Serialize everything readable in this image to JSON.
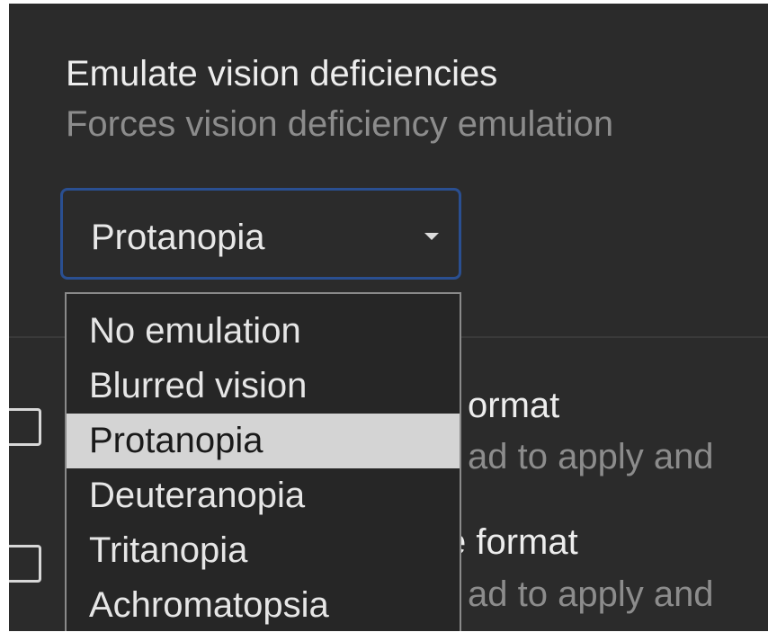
{
  "setting": {
    "title": "Emulate vision deficiencies",
    "description": "Forces vision deficiency emulation",
    "selected_value": "Protanopia",
    "arrow_icon": "caret-down-icon"
  },
  "dropdown": {
    "options": [
      "No emulation",
      "Blurred vision",
      "Protanopia",
      "Deuteranopia",
      "Tritanopia",
      "Achromatopsia"
    ],
    "highlighted_index": 2
  },
  "background_settings": [
    {
      "label_visible": "ormat",
      "description_visible": "ad to apply and",
      "checked": false
    },
    {
      "label_visible": "e format",
      "description_visible": "ad to apply and",
      "checked": false
    }
  ],
  "colors": {
    "panel_bg": "#2b2b2b",
    "focus_border": "#2a4f91",
    "highlight_bg": "#d4d4d4"
  }
}
